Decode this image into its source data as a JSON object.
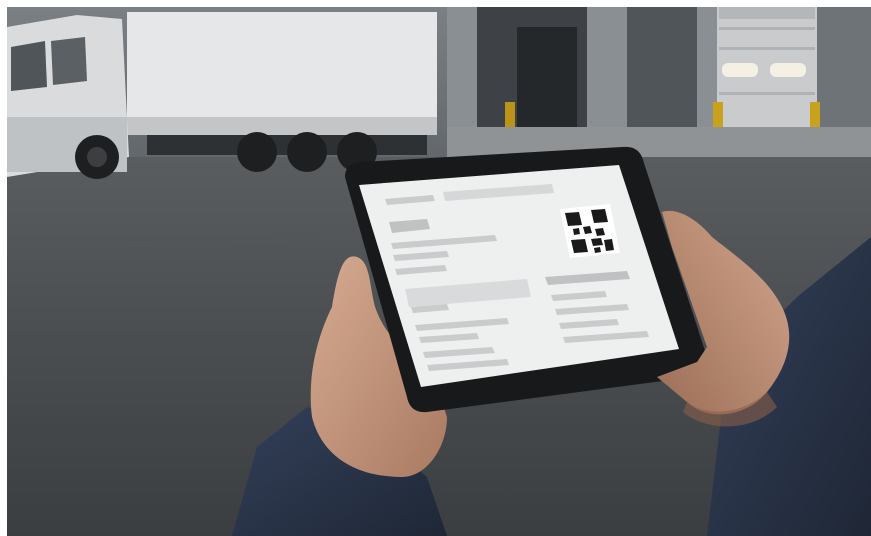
{
  "scene": {
    "colors": {
      "sky_wall": "#6f7478",
      "asphalt": "#4a4d50",
      "trailer": "#e6e7e8",
      "cab": "#d9dbdd",
      "dock_door": "#c9cbcc",
      "dock_light": "#f4f1e4",
      "tablet_frame": "#17191b",
      "screen": "#eeefef",
      "screen_block": "#c9cbcc",
      "skin": "#c99a80",
      "sleeve": "#2b3442"
    },
    "icons": {
      "qr_code": "qr-code-icon"
    }
  }
}
